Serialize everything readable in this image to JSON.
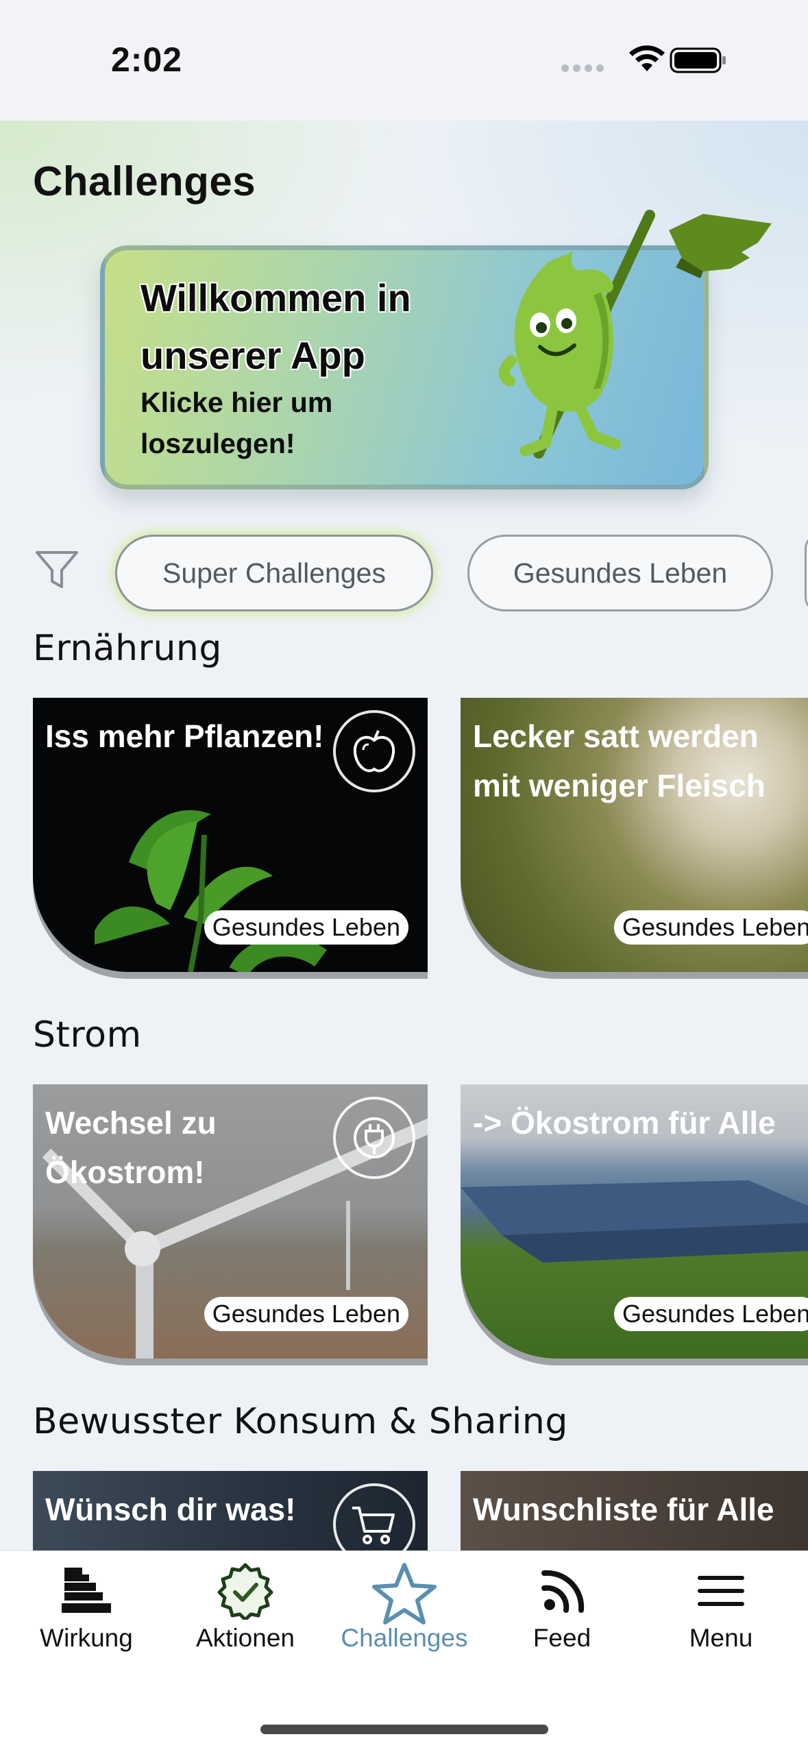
{
  "status_bar": {
    "time": "2:02"
  },
  "page": {
    "title": "Challenges"
  },
  "banner": {
    "heading": "Willkommen in unserer App",
    "subtext": "Klicke hier um loszulegen!"
  },
  "filters": {
    "icon": "filter-icon",
    "chips": [
      "Super Challenges",
      "Gesundes Leben"
    ]
  },
  "sections": [
    {
      "title": "Ernährung",
      "cards": [
        {
          "title": "Iss mehr Pflanzen!",
          "badge": "Gesundes Leben",
          "icon": "apple-icon"
        },
        {
          "title": "Lecker satt werden mit weniger Fleisch",
          "badge": "Gesundes Leben",
          "icon": "apple-icon"
        }
      ]
    },
    {
      "title": "Strom",
      "cards": [
        {
          "title": "Wechsel zu Ökostrom!",
          "badge": "Gesundes Leben",
          "icon": "plug-icon"
        },
        {
          "title": "-> Ökostrom für Alle",
          "badge": "Gesundes Leben"
        }
      ]
    },
    {
      "title": "Bewusster Konsum & Sharing",
      "cards": [
        {
          "title": "Wünsch dir was!",
          "icon": "cart-icon"
        },
        {
          "title": "Wunschliste für Alle"
        }
      ]
    }
  ],
  "bottom_nav": [
    {
      "label": "Wirkung",
      "icon": "impact-icon"
    },
    {
      "label": "Aktionen",
      "icon": "badge-check-icon"
    },
    {
      "label": "Challenges",
      "icon": "star-icon",
      "active": true
    },
    {
      "label": "Feed",
      "icon": "rss-icon"
    },
    {
      "label": "Menu",
      "icon": "hamburger-icon"
    }
  ],
  "colors": {
    "accent": "#5a8fb0",
    "banner_green": "#c6df86",
    "banner_blue": "#7ab7d9",
    "mascot_green": "#8cc63f"
  }
}
